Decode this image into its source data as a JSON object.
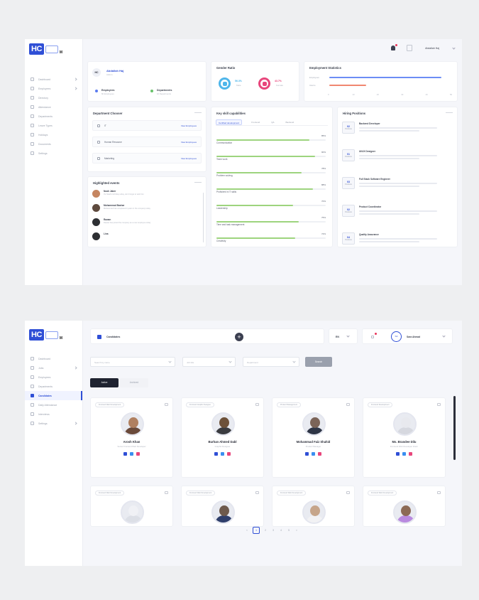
{
  "shot1": {
    "logo": {
      "mark": "HC",
      "sub": "M"
    },
    "header": {
      "user_name": "Abdallah Haj"
    },
    "sidebar": {
      "items": [
        {
          "label": "Dashboard",
          "chev": true,
          "active": false
        },
        {
          "label": "Employees",
          "chev": true,
          "active": false
        },
        {
          "label": "Directory",
          "chev": false,
          "active": false
        },
        {
          "label": "Attendance",
          "chev": false,
          "active": false
        },
        {
          "label": "Departments",
          "chev": false,
          "active": false
        },
        {
          "label": "Leave Types",
          "chev": false,
          "active": false
        },
        {
          "label": "Holidays",
          "chev": false,
          "active": false
        },
        {
          "label": "Documents",
          "chev": false,
          "active": false
        },
        {
          "label": "Settings",
          "chev": false,
          "active": false
        }
      ]
    },
    "profile": {
      "badge": "HC",
      "name": "Abdallah Haj",
      "subtitle": "Admin",
      "stats": [
        {
          "title": "Employees",
          "sub": "60 Employees",
          "color": "#5b7cf0"
        },
        {
          "title": "Departments",
          "sub": "10 Departments",
          "color": "#69c36b"
        }
      ]
    },
    "gender": {
      "title": "Gender Ratio",
      "male": {
        "value": "56.3%",
        "label": "Male",
        "color": "#4fb6ea"
      },
      "female": {
        "value": "43.7%",
        "label": "Female",
        "color": "#e8467c"
      }
    },
    "employment": {
      "title": "Employment Statistics",
      "rows": [
        {
          "label": "Employees",
          "value": 0.92,
          "color": "#6c8df5"
        },
        {
          "label": "Interns",
          "value": 0.3,
          "color": "#f08770"
        }
      ],
      "ticks": [
        "0",
        "10",
        "20",
        "30",
        "40",
        "50"
      ]
    },
    "dept_chooser": {
      "title": "Department Chooser",
      "more": "View all",
      "items": [
        {
          "name": "IT",
          "link": "View Employees"
        },
        {
          "name": "Human Resource",
          "link": "View Employees"
        },
        {
          "name": "Marketing",
          "link": "View Employees"
        }
      ]
    },
    "events": {
      "title": "Highlighted events",
      "more": "View all",
      "items": [
        {
          "name": "Noah Jaber",
          "desc": "It's Noah's birthday today, don't forget to wish him",
          "color": "#c58560"
        },
        {
          "name": "Mohammad Bashar",
          "desc": "Mohammad has completed 3 years in the company today",
          "color": "#5e4a3e"
        },
        {
          "name": "Rawan",
          "desc": "Rawan has joined the company as a new employee today",
          "color": "#2d2f33"
        },
        {
          "name": "Lina",
          "desc": "",
          "color": "#2d2f33"
        }
      ]
    },
    "skills": {
      "title": "Key skill capabilities",
      "tabs": [
        "Certified development",
        "Frontend",
        "QA",
        "Backend"
      ],
      "items": [
        {
          "name": "Communication",
          "value": "85%",
          "pct": 0.85
        },
        {
          "name": "Team work",
          "value": "90%",
          "pct": 0.9
        },
        {
          "name": "Problem solving",
          "value": "78%",
          "pct": 0.78
        },
        {
          "name": "Proficient in IT skills",
          "value": "88%",
          "pct": 0.88
        },
        {
          "name": "Leadership",
          "value": "70%",
          "pct": 0.7
        },
        {
          "name": "Time and task management",
          "value": "75%",
          "pct": 0.75
        },
        {
          "name": "Creativity",
          "value": "72%",
          "pct": 0.72
        }
      ]
    },
    "hiring": {
      "title": "Hiring Positions",
      "items": [
        {
          "count": "02",
          "unit": "Positions",
          "title": "Backend Developer"
        },
        {
          "count": "01",
          "unit": "Positions",
          "title": "UI/UX Designer"
        },
        {
          "count": "03",
          "unit": "Positions",
          "title": "Full Stack Software Engineer"
        },
        {
          "count": "02",
          "unit": "Positions",
          "title": "Product Coordinator"
        },
        {
          "count": "04",
          "unit": "Positions",
          "title": "Quality Assurance"
        }
      ]
    }
  },
  "shot2": {
    "logo": {
      "mark": "HC",
      "sub": "M"
    },
    "header": {
      "title": "Candidates",
      "lang": "EN",
      "user_initials": "SA",
      "user_name": "Sara Ahmad"
    },
    "sidebar": {
      "items": [
        {
          "label": "Dashboard",
          "chev": false,
          "active": false
        },
        {
          "label": "Jobs",
          "chev": true,
          "active": false
        },
        {
          "label": "Employees",
          "chev": false,
          "active": false
        },
        {
          "label": "Departments",
          "chev": false,
          "active": false
        },
        {
          "label": "Candidates",
          "chev": false,
          "active": true
        },
        {
          "label": "Daily Attendance",
          "chev": false,
          "active": false
        },
        {
          "label": "Interviews",
          "chev": false,
          "active": false
        },
        {
          "label": "Settings",
          "chev": true,
          "active": false
        }
      ]
    },
    "filters": [
      {
        "placeholder": "Search by name"
      },
      {
        "placeholder": "Job title"
      },
      {
        "placeholder": "Department"
      }
    ],
    "search_label": "Search",
    "segments": [
      "Active",
      "Archived"
    ],
    "employees": [
      {
        "tag": "Frontend Web Development",
        "name": "Arosh Khan",
        "role": "Senior Frontend Web Developer",
        "skin": "#b08060",
        "cloth": "#6a4a3a"
      },
      {
        "tag": "Frontend Graphic Designer",
        "name": "Burhan Ahmed Dabl",
        "role": "Graphic Designer",
        "skin": "#6d5139",
        "cloth": "#3a3b3f"
      },
      {
        "tag": "Product Management",
        "name": "Mohammad Faiz Shahid",
        "role": "Product Manager",
        "skin": "#7b6458",
        "cloth": "#2e3546"
      },
      {
        "tag": "Frontend Development",
        "name": "Ms. Brandee Dilu",
        "role": "Frontend Web Developer Intern",
        "skin": "#e8e9ee",
        "cloth": "#d6d8df"
      },
      {
        "tag": "Frontend Web Development",
        "name": "",
        "role": "",
        "skin": "#f0f1f5",
        "cloth": "#dcdfe6"
      },
      {
        "tag": "Frontend Web Development",
        "name": "",
        "role": "",
        "skin": "#6e5a4c",
        "cloth": "#2f3f6b"
      },
      {
        "tag": "Frontend Web Development",
        "name": "",
        "role": "",
        "skin": "#c6a58a",
        "cloth": "#f2f2f4"
      },
      {
        "tag": "Frontend Web Development",
        "name": "",
        "role": "",
        "skin": "#8c6a55",
        "cloth": "#b98adf"
      }
    ],
    "pagination": [
      "<",
      "1",
      "2",
      "3",
      "4",
      "5",
      ">"
    ],
    "current_page": "1"
  }
}
